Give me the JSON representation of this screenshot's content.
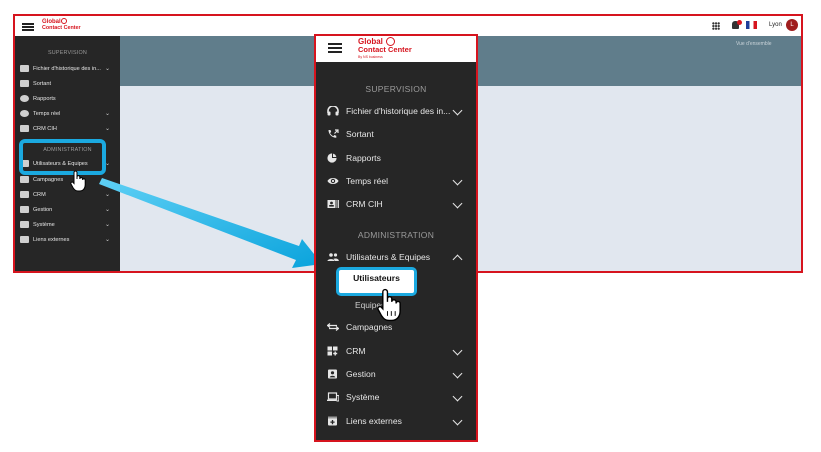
{
  "bg": {
    "logo_line1": "Global",
    "logo_line2": "Contact Center",
    "user_name": "Lyon",
    "avatar_letter": "L",
    "banner_text": "Vue d'ensemble",
    "sections": {
      "supervision": "SUPERVISION",
      "administration": "ADMINISTRATION"
    },
    "items": [
      "Fichier d'historique des in...",
      "Sortant",
      "Rapports",
      "Temps réel",
      "CRM CIH",
      "Utilisateurs & Equipes",
      "Campagnes",
      "CRM",
      "Gestion",
      "Système",
      "Liens externes"
    ]
  },
  "zoom": {
    "logo_line1": "Global",
    "logo_line2": "Contact Center",
    "logo_tagline": "By NS business",
    "sections": {
      "supervision": "SUPERVISION",
      "administration": "ADMINISTRATION"
    },
    "items": {
      "fichier": "Fichier d'historique des in...",
      "sortant": "Sortant",
      "rapports": "Rapports",
      "temps_reel": "Temps réel",
      "crm_cih": "CRM CIH",
      "utilisateurs_equipes": "Utilisateurs & Equipes",
      "utilisateurs": "Utilisateurs",
      "equipes": "Equipes",
      "campagnes": "Campagnes",
      "crm": "CRM",
      "gestion": "Gestion",
      "systeme": "Système",
      "liens_externes": "Liens externes"
    }
  },
  "colors": {
    "brand_red": "#d6141e",
    "highlight_blue": "#1ba9e0",
    "sidebar": "#262626",
    "banner": "#607d8b",
    "content": "#e1e7ef"
  }
}
